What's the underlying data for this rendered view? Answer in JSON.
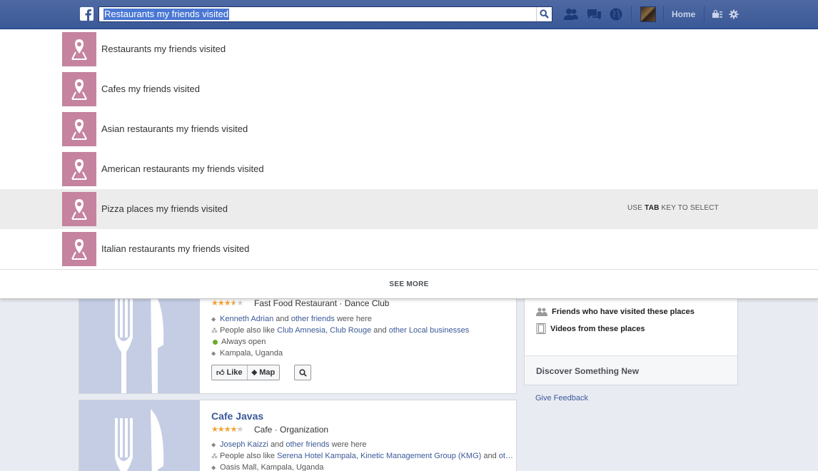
{
  "topbar": {
    "search_value": "Restaurants my friends visited",
    "home_label": "Home",
    "icons": [
      "facebook-logo",
      "friend-requests-icon",
      "messages-icon",
      "notifications-globe-icon",
      "profile-avatar",
      "privacy-lock-icon",
      "settings-gear-icon"
    ],
    "brand_color": "#3b5998"
  },
  "suggestions": [
    {
      "label": "Restaurants my friends visited",
      "icon": "place-pin-icon"
    },
    {
      "label": "Cafes my friends visited",
      "icon": "place-pin-icon"
    },
    {
      "label": "Asian restaurants my friends visited",
      "icon": "place-pin-icon"
    },
    {
      "label": "American restaurants my friends visited",
      "icon": "place-pin-icon"
    },
    {
      "label": "Pizza places my friends visited",
      "icon": "place-pin-icon",
      "selected": true
    },
    {
      "label": "Italian restaurants my friends visited",
      "icon": "place-pin-icon"
    }
  ],
  "tab_hint": {
    "prefix": "USE ",
    "key": "TAB",
    "suffix": " KEY TO SELECT"
  },
  "see_more": "SEE MORE",
  "results": [
    {
      "rating": 3,
      "categories": "Fast Food Restaurant · Dance Club",
      "friend": "Kenneth Adrian",
      "and_text": "and",
      "other_friends": "other friends",
      "were_here": "were here",
      "people_also_like_prefix": "People also like",
      "also_like_1": "Club Amnesia",
      "also_like_sep": ",",
      "also_like_2": "Club Rouge",
      "also_like_and": "and",
      "also_like_3": "other Local businesses",
      "hours": "Always open",
      "location": "Kampala, Uganda",
      "like_label": "Like",
      "map_label": "Map"
    },
    {
      "title": "Cafe Javas",
      "rating": 3.5,
      "categories": "Cafe · Organization",
      "friend": "Joseph Kaizzi",
      "and_text": "and",
      "other_friends": "other friends",
      "were_here": "were here",
      "people_also_like_prefix": "People also like",
      "also_like_1": "Serena Hotel Kampala",
      "also_like_sep": ",",
      "also_like_2": "Kinetic Management Group (KMG)",
      "also_like_and": "and",
      "also_like_3": "ot…",
      "location": "Oasis Mall, Kampala, Uganda"
    }
  ],
  "sidebar": {
    "items": [
      "Friends who have visited these places",
      "Videos from these places"
    ],
    "discover": "Discover Something New",
    "feedback": "Give Feedback"
  }
}
